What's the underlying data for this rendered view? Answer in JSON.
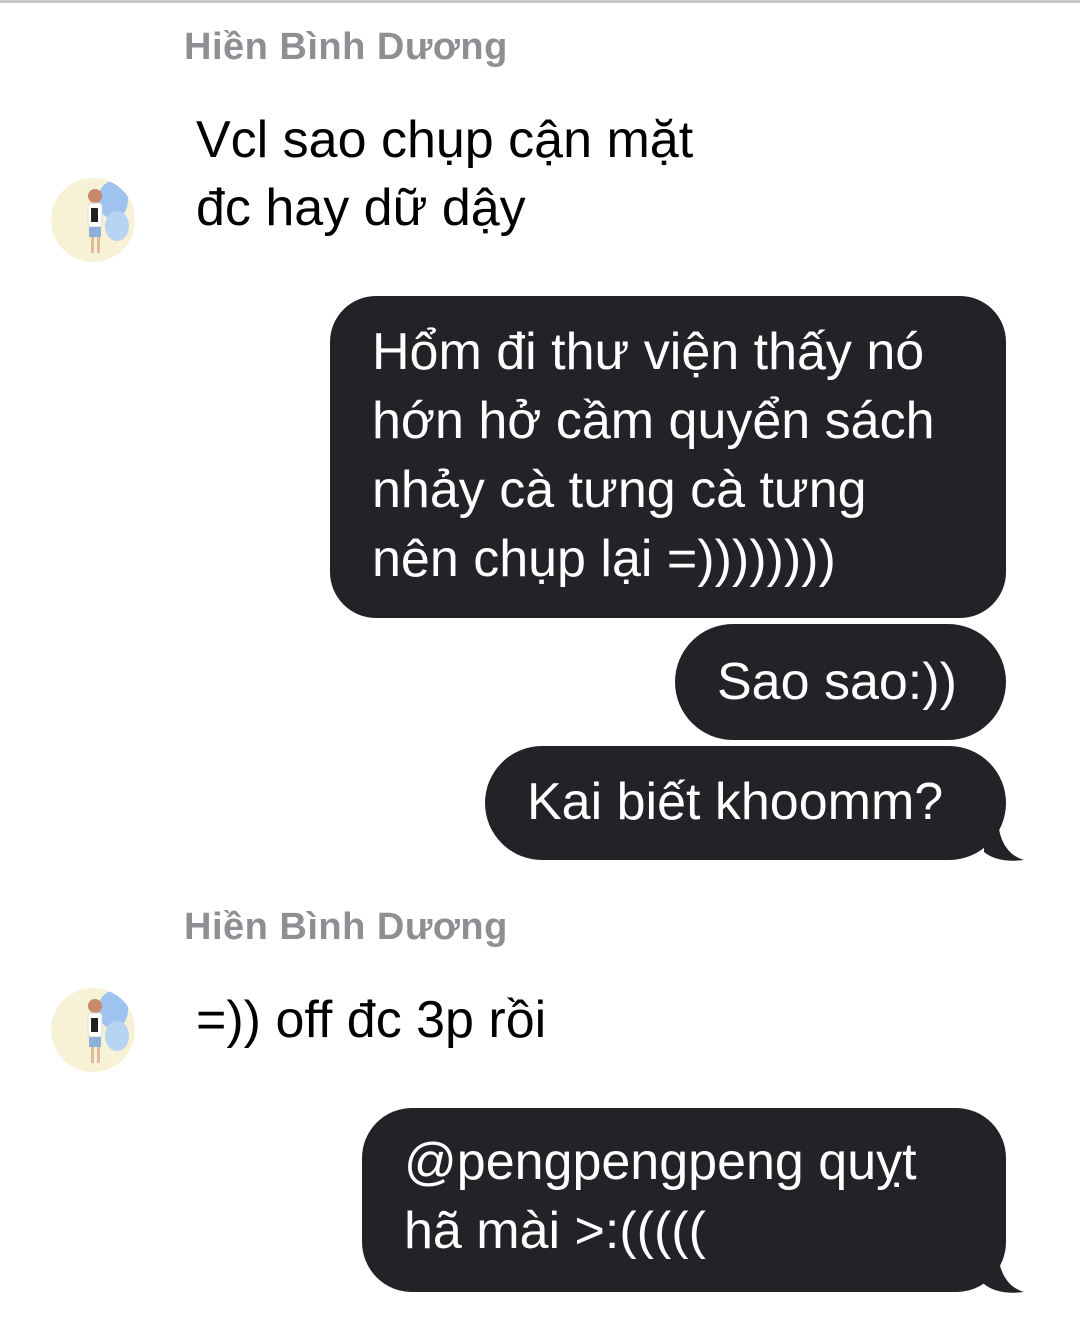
{
  "conversation": {
    "messages": [
      {
        "direction": "incoming",
        "sender": "Hiền Bình Dương",
        "lines": [
          "Vcl sao chụp cận mặt",
          "đc hay dữ dậy"
        ]
      },
      {
        "direction": "outgoing",
        "lines": [
          "Hổm đi thư viện thấy nó",
          "hớn hở cầm quyển sách",
          "nhảy cà tưng cà tưng",
          "nên chụp lại =))))))))"
        ]
      },
      {
        "direction": "outgoing",
        "lines": [
          "Sao sao:))"
        ]
      },
      {
        "direction": "outgoing",
        "lines": [
          "Kai biết khoomm?"
        ]
      },
      {
        "direction": "incoming",
        "sender": "Hiền Bình Dương",
        "lines": [
          "=)) off đc 3p rồi"
        ]
      },
      {
        "direction": "outgoing",
        "lines": [
          "@pengpengpeng quỵt",
          "hã mài >:((((("
        ]
      }
    ]
  },
  "colors": {
    "outgoing_bubble": "#232227",
    "outgoing_text": "#ffffff",
    "incoming_text": "#000000",
    "sender_name": "#8e8e93",
    "avatar_background": "#f7f2d6",
    "avatar_wings": "#9ec3ef"
  },
  "icons": {
    "avatar": "avatar-photo-icon"
  }
}
